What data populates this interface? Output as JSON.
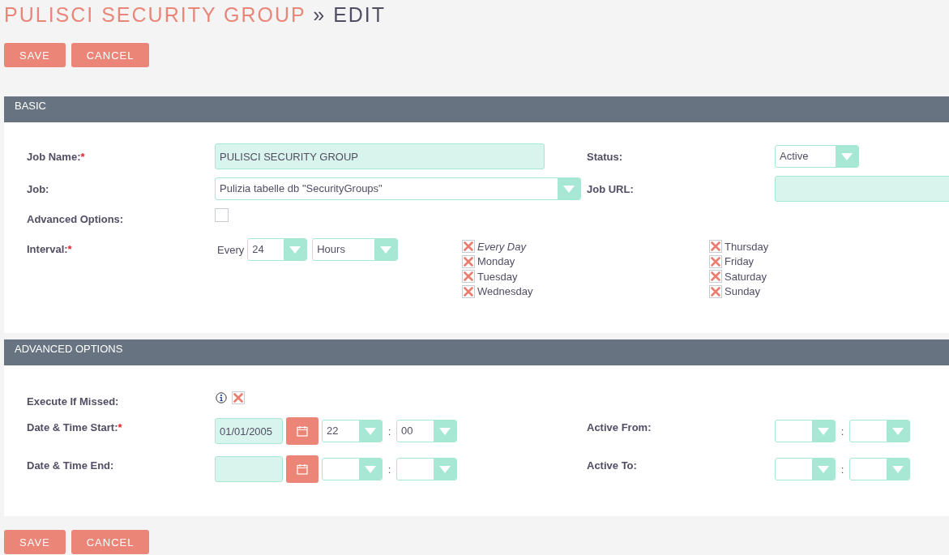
{
  "title": {
    "module": "PULISCI SECURITY GROUP",
    "separator": "»",
    "action": "EDIT"
  },
  "top_buttons": [
    {
      "label": "SAVE"
    },
    {
      "label": "CANCEL"
    }
  ],
  "basic": {
    "header": "BASIC",
    "job_name": {
      "label": "Job Name:",
      "required_mark": "*",
      "value": "PULISCI SECURITY GROUP"
    },
    "status": {
      "label": "Status:",
      "value": "Active"
    },
    "job": {
      "label": "Job:",
      "value": "Pulizia tabelle db \"SecurityGroups\""
    },
    "job_url": {
      "label": "Job URL:"
    },
    "advanced_options": {
      "label": "Advanced Options:",
      "checked": false
    },
    "interval": {
      "label": "Interval:",
      "required_mark": "*",
      "every": "Every",
      "number": "24",
      "unit": "Hours",
      "days": [
        {
          "label": "Every Day",
          "kind": "all",
          "checked": true
        },
        {
          "label": "Monday",
          "kind": "day",
          "checked": true
        },
        {
          "label": "Tuesday",
          "kind": "day",
          "checked": true
        },
        {
          "label": "Wednesday",
          "kind": "day",
          "checked": true
        },
        {
          "label": "Thursday",
          "kind": "day",
          "checked": true
        },
        {
          "label": "Friday",
          "kind": "day",
          "checked": true
        },
        {
          "label": "Saturday",
          "kind": "day",
          "checked": true
        },
        {
          "label": "Sunday",
          "kind": "day",
          "checked": true
        }
      ]
    }
  },
  "advanced": {
    "header": "ADVANCED OPTIONS",
    "execute_if_missed": {
      "label": "Execute If Missed:",
      "checked": true
    },
    "date_start": {
      "label": "Date & Time Start:",
      "required_mark": "*",
      "date": "01/01/2005",
      "hour": "22",
      "separator": ":",
      "minute": "00"
    },
    "date_end": {
      "label": "Date & Time End:",
      "separator": ":"
    },
    "active_from": {
      "label": "Active From:",
      "separator": ":"
    },
    "active_to": {
      "label": "Active To:",
      "separator": ":"
    }
  },
  "bottom_buttons": [
    {
      "label": "SAVE"
    },
    {
      "label": "CANCEL"
    }
  ]
}
